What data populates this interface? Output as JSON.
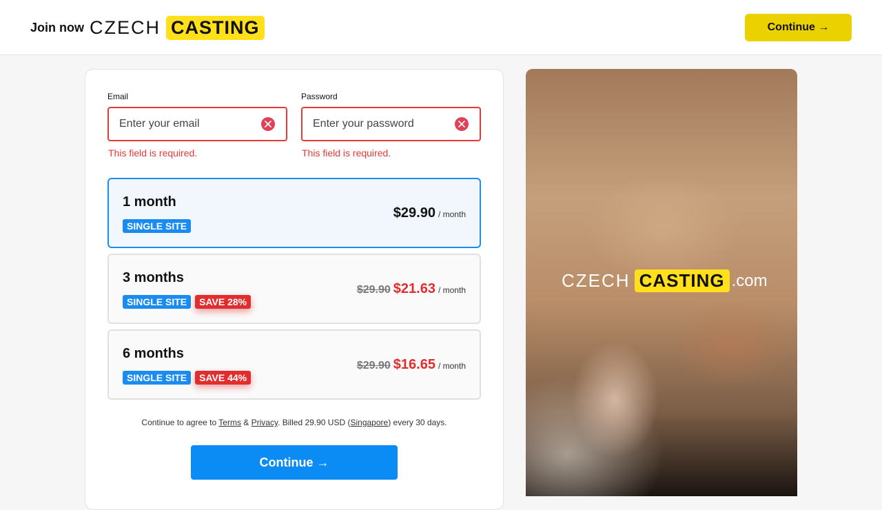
{
  "header": {
    "join_now": "Join now",
    "logo_czech": "CZECH",
    "logo_casting": "CASTING",
    "continue_label": "Continue →"
  },
  "form": {
    "email": {
      "label": "Email",
      "placeholder": "Enter your email",
      "error": "This field is required."
    },
    "password": {
      "label": "Password",
      "placeholder": "Enter your password",
      "error": "This field is required."
    }
  },
  "plans": [
    {
      "title": "1 month",
      "badge_site": "SINGLE SITE",
      "badge_save": "",
      "old_price": "",
      "price": "$29.90",
      "per": "/ month",
      "selected": true
    },
    {
      "title": "3 months",
      "badge_site": "SINGLE SITE",
      "badge_save": "SAVE 28%",
      "old_price": "$29.90",
      "price": "$21.63",
      "per": "/ month",
      "selected": false
    },
    {
      "title": "6 months",
      "badge_site": "SINGLE SITE",
      "badge_save": "SAVE 44%",
      "old_price": "$29.90",
      "price": "$16.65",
      "per": "/ month",
      "selected": false
    }
  ],
  "terms": {
    "prefix": "Continue to agree to ",
    "terms_link": "Terms",
    "amp": " & ",
    "privacy_link": "Privacy",
    "billed": ". Billed 29.90 USD (",
    "country_link": "Singapore",
    "suffix": ") every 30 days."
  },
  "main_continue_label": "Continue →",
  "promo": {
    "czech": "CZECH",
    "casting": "CASTING",
    "com": ".com"
  },
  "colors": {
    "accent_yellow": "#ecd100",
    "brand_yellow": "#ffe01b",
    "primary_blue": "#0b8cf5",
    "error_red": "#e53935",
    "save_red": "#e02d2d"
  },
  "icons": {
    "clear": "close-circle-icon",
    "arrow": "arrow-right"
  }
}
